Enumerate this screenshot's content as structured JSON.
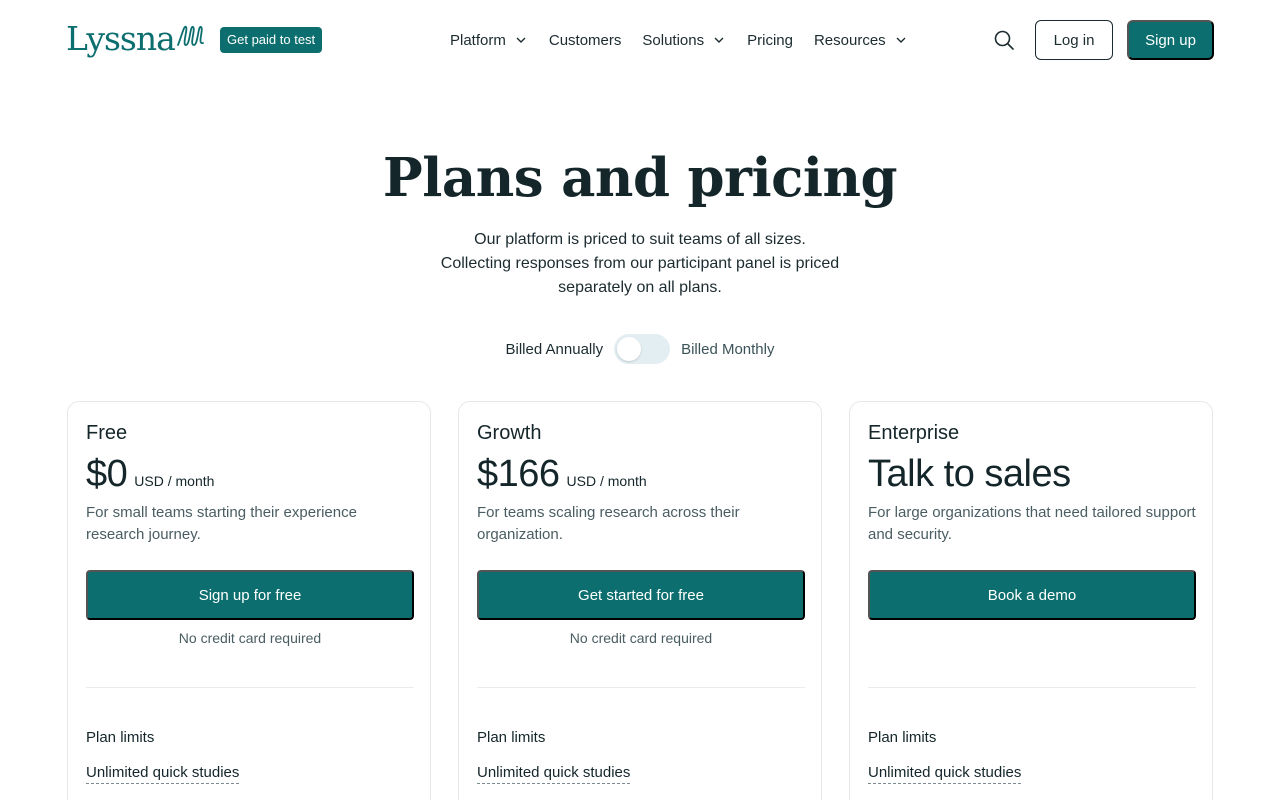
{
  "header": {
    "logo_text": "Lyssna",
    "badge": "Get paid to test",
    "nav": [
      {
        "label": "Platform",
        "dropdown": true
      },
      {
        "label": "Customers",
        "dropdown": false
      },
      {
        "label": "Solutions",
        "dropdown": true
      },
      {
        "label": "Pricing",
        "dropdown": false
      },
      {
        "label": "Resources",
        "dropdown": true
      }
    ],
    "search_icon": "search-icon",
    "login_label": "Log in",
    "signup_label": "Sign up"
  },
  "hero": {
    "title": "Plans and pricing",
    "subtitle": "Our platform is priced to suit teams of all sizes. Collecting responses from our participant panel is priced separately on all plans."
  },
  "billing": {
    "annual_label": "Billed Annually",
    "monthly_label": "Billed Monthly",
    "toggle_state": "annually"
  },
  "plans": [
    {
      "name": "Free",
      "price": "$0",
      "unit": "USD / month",
      "description": "For small teams starting their experience research journey.",
      "cta": "Sign up for free",
      "note": "No credit card required",
      "limits_title": "Plan limits",
      "limit_item": "Unlimited quick studies"
    },
    {
      "name": "Growth",
      "price": "$166",
      "unit": "USD / month",
      "description": "For teams scaling research across their organization.",
      "cta": "Get started for free",
      "note": "No credit card required",
      "limits_title": "Plan limits",
      "limit_item": "Unlimited quick studies"
    },
    {
      "name": "Enterprise",
      "price": "Talk to sales",
      "unit": "",
      "description": "For large organizations that need tailored support and security.",
      "cta": "Book a demo",
      "note": "",
      "limits_title": "Plan limits",
      "limit_item": "Unlimited quick studies"
    }
  ],
  "colors": {
    "brand": "#0c6e6e",
    "text": "#1b2b2f",
    "muted": "#4a5d62",
    "toggle_track": "#e3eef2",
    "card_border": "#e4e8ea"
  }
}
